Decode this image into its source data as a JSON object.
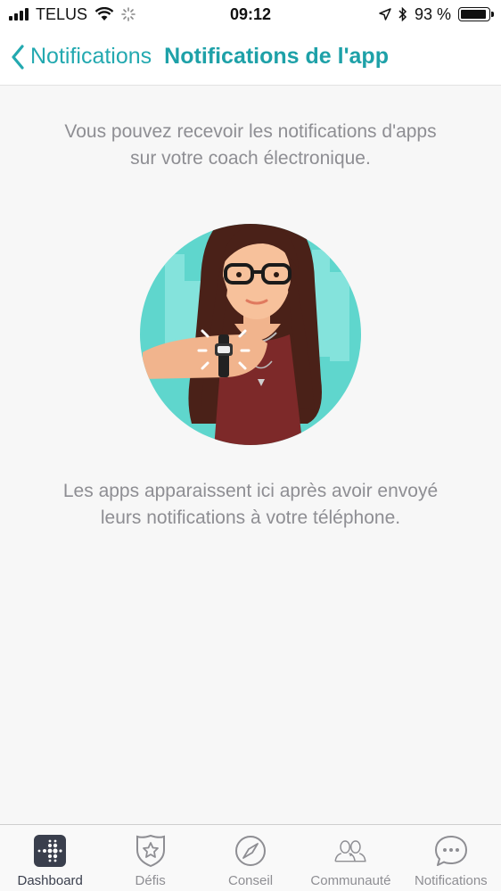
{
  "status_bar": {
    "carrier": "TELUS",
    "time": "09:12",
    "battery_percent": "93 %",
    "battery_level": 0.93
  },
  "header": {
    "back_label": "Notifications",
    "title": "Notifications de l'app"
  },
  "content": {
    "intro_line1": "Vous pouvez recevoir les notifications d'apps",
    "intro_line2": "sur votre coach électronique.",
    "footer_line1": "Les apps apparaissent ici après avoir envoyé",
    "footer_line2": "leurs notifications à votre téléphone."
  },
  "tab_bar": {
    "tabs": [
      {
        "label": "Dashboard",
        "icon": "dashboard-icon",
        "active": true
      },
      {
        "label": "Défis",
        "icon": "star-shield-icon",
        "active": false
      },
      {
        "label": "Conseil",
        "icon": "compass-icon",
        "active": false
      },
      {
        "label": "Communauté",
        "icon": "people-icon",
        "active": false
      },
      {
        "label": "Notifications",
        "icon": "chat-bubble-icon",
        "active": false
      }
    ]
  },
  "colors": {
    "accent": "#1ea1a8",
    "text_muted": "#8e8e93",
    "illustration_bg": "#5fd6cd"
  }
}
